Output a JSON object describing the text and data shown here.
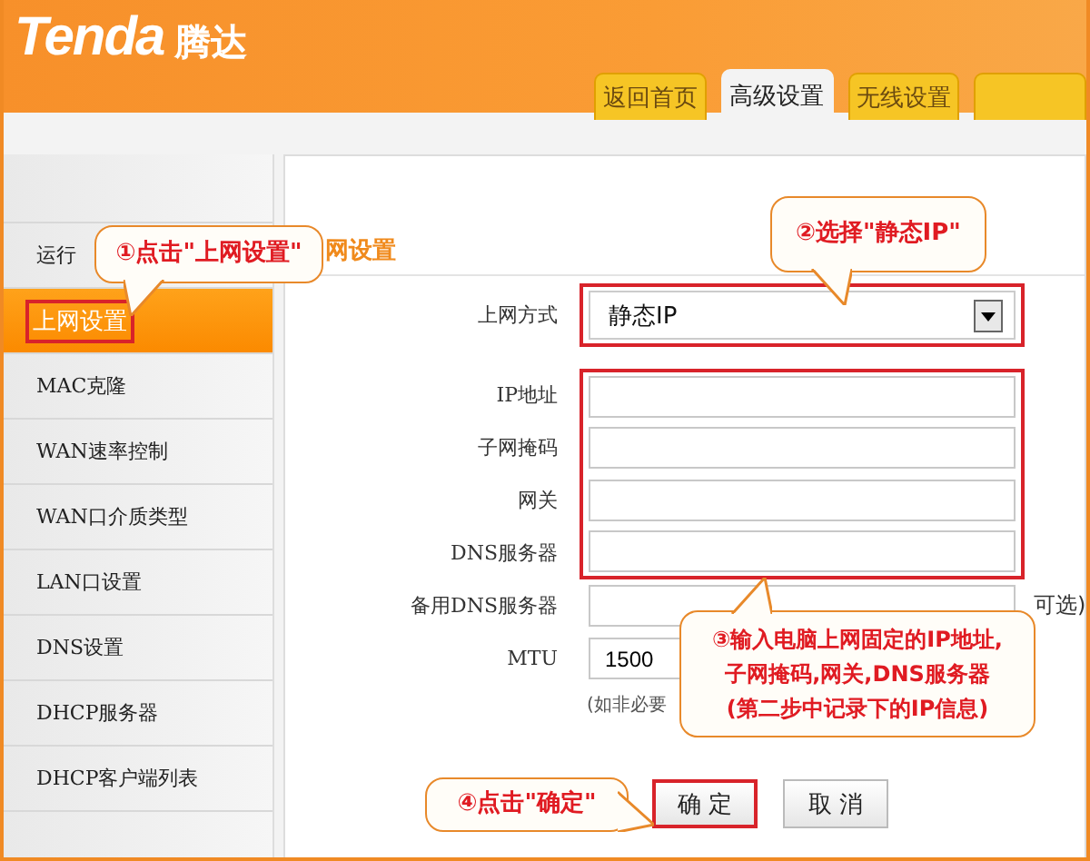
{
  "brand": {
    "logo": "Tenda",
    "name": "腾达"
  },
  "tabs": [
    {
      "label": "返回首页",
      "selected": false
    },
    {
      "label": "高级设置",
      "selected": true
    },
    {
      "label": "无线设置",
      "selected": false
    },
    {
      "selected": false
    }
  ],
  "sidebar": {
    "items": [
      {
        "label": "运行",
        "selected": false,
        "highlighted": false
      },
      {
        "label": "上网设置",
        "selected": true,
        "highlighted": true
      },
      {
        "label": "MAC克隆",
        "selected": false,
        "highlighted": false
      },
      {
        "label": "WAN速率控制",
        "selected": false,
        "highlighted": false
      },
      {
        "label": "WAN口介质类型",
        "selected": false,
        "highlighted": false
      },
      {
        "label": "LAN口设置",
        "selected": false,
        "highlighted": false
      },
      {
        "label": "DNS设置",
        "selected": false,
        "highlighted": false
      },
      {
        "label": "DHCP服务器",
        "selected": false,
        "highlighted": false
      },
      {
        "label": "DHCP客户端列表",
        "selected": false,
        "highlighted": false
      }
    ]
  },
  "section_title": "网设置",
  "form": [
    {
      "kind": "select",
      "label": "上网方式",
      "value": "静态IP",
      "highlighted": true
    },
    {
      "kind": "input",
      "label": "IP地址",
      "highlighted": true
    },
    {
      "kind": "input",
      "label": "子网掩码",
      "highlighted": true
    },
    {
      "kind": "input",
      "label": "网关",
      "highlighted": true
    },
    {
      "kind": "input",
      "label": "DNS服务器",
      "highlighted": true
    },
    {
      "kind": "input",
      "label": "备用DNS服务器",
      "highlighted": false,
      "note": "可选)"
    },
    {
      "kind": "input",
      "label": "MTU",
      "value": "1500",
      "highlighted": false
    }
  ],
  "hint": "(如非必要",
  "buttons": [
    {
      "label": "确 定",
      "highlighted": true
    },
    {
      "label": "取 消",
      "highlighted": false
    }
  ],
  "callouts": [
    {
      "lines": [
        "①点击\"上网设置\""
      ]
    },
    {
      "lines": [
        "②选择\"静态IP\""
      ]
    },
    {
      "lines": [
        "③输入电脑上网固定的IP地址,",
        "子网掩码,网关,DNS服务器",
        "(第二步中记录下的IP信息)"
      ]
    },
    {
      "lines": [
        "④点击\"确定\""
      ]
    }
  ]
}
